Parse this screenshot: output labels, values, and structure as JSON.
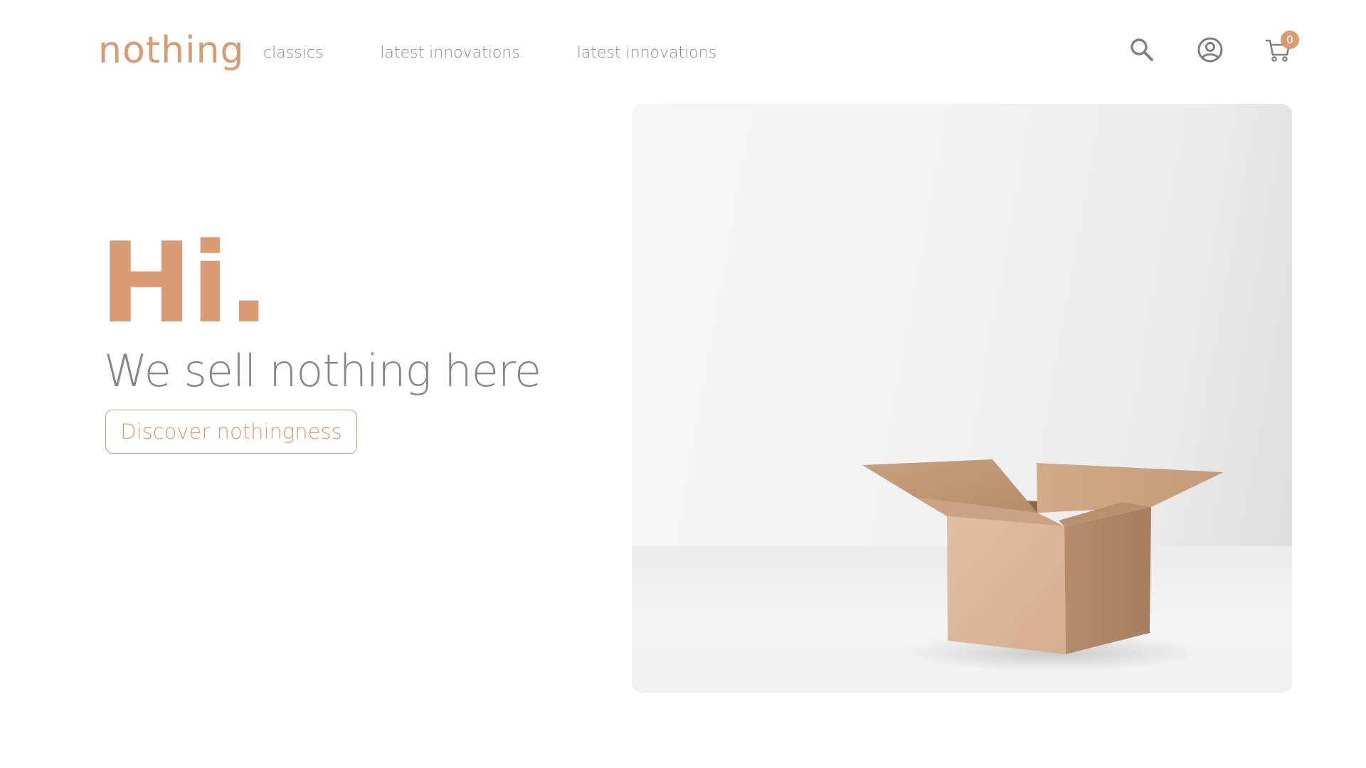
{
  "brand": {
    "logo_text": "nothing",
    "accent_color": "#d89b74"
  },
  "nav": {
    "items": [
      {
        "label": "classics"
      },
      {
        "label": "latest innovations"
      },
      {
        "label": "latest innovations"
      }
    ]
  },
  "header_icons": {
    "search": {
      "icon": "search-icon"
    },
    "account": {
      "icon": "user-circle-icon"
    },
    "cart": {
      "icon": "cart-icon",
      "count": "0"
    }
  },
  "hero": {
    "greeting": "Hi.",
    "tagline": "We sell nothing here",
    "cta_label": "Discover nothingness",
    "image": {
      "subject": "open-cardboard-box"
    }
  }
}
